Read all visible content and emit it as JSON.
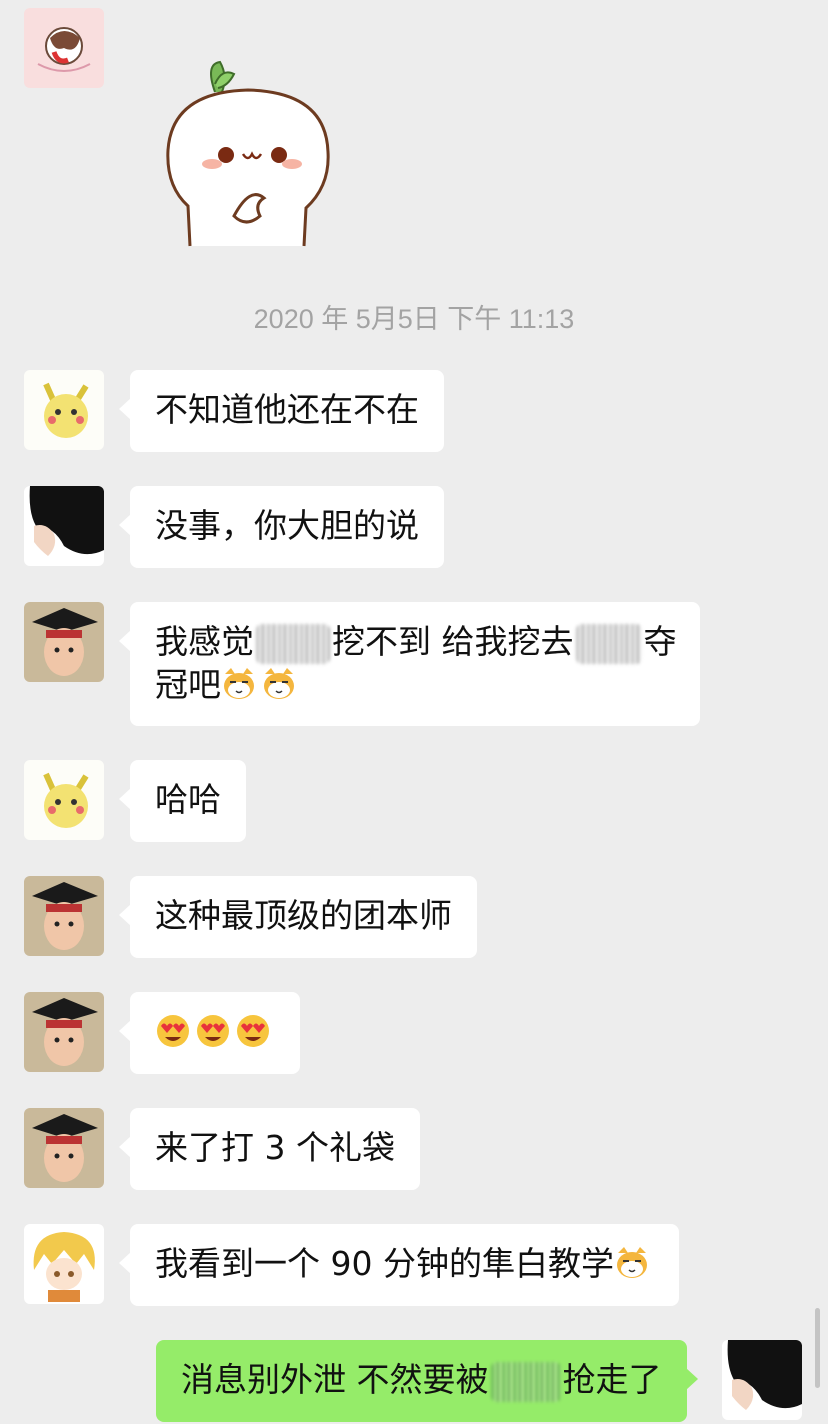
{
  "timestamp": "2020 年 5月5日 下午 11:13",
  "messages": [
    {
      "text": "不知道他还在不在"
    },
    {
      "text": "没事，你大胆的说"
    },
    {
      "line1_a": "我感觉",
      "line1_b": "挖不到 给我挖去",
      "line1_c": "夺",
      "line2": "冠吧",
      "emojis": [
        "cat-emoji",
        "cat-emoji"
      ]
    },
    {
      "text": "哈哈"
    },
    {
      "text": "这种最顶级的团本师"
    },
    {
      "emojis": [
        "heart-eyes-emoji",
        "heart-eyes-emoji",
        "heart-eyes-emoji"
      ]
    },
    {
      "text": "来了打 3 个礼袋"
    },
    {
      "text": "我看到一个 90 分钟的隼白教学",
      "emojis": [
        "cat-emoji"
      ]
    },
    {
      "text_a": "消息别外泄 不然要被",
      "text_b": "抢走了",
      "outgoing": true
    }
  ],
  "avatars": [
    "cartoon-girl-avatar",
    "pikachu-avatar",
    "dark-hair-avatar",
    "graduate-boy-avatar",
    "anime-boy-avatar"
  ],
  "sticker": "white-bun-sticker",
  "colors": {
    "background": "#ededed",
    "incoming": "#ffffff",
    "outgoing": "#95ec69",
    "timestamp": "#a3a3a3"
  }
}
